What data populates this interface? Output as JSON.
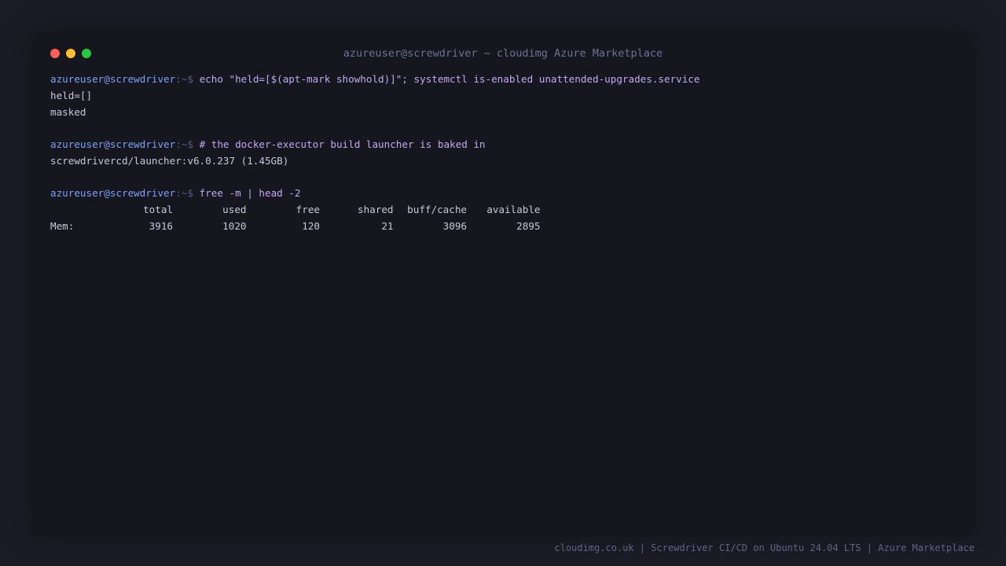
{
  "window": {
    "title": "azureuser@screwdriver ~ cloudimg Azure Marketplace",
    "controls": [
      {
        "name": "close",
        "color": "#ff5f57"
      },
      {
        "name": "minimize",
        "color": "#febc2e"
      },
      {
        "name": "maximize",
        "color": "#28c840"
      }
    ]
  },
  "terminal": {
    "prompt_user": "azureuser@screwdriver",
    "prompt_path": ":~$",
    "commands": [
      {
        "command": "echo \"held=[$(apt-mark showhold)]\"; systemctl is-enabled unattended-upgrades.service",
        "output": [
          "held=[]",
          "masked"
        ]
      },
      {
        "command": "# the docker-executor build launcher is baked in",
        "output": [
          "screwdrivercd/launcher:v6.0.237 (1.45GB)"
        ]
      },
      {
        "command": "free -m | head -2",
        "table": {
          "headers": [
            "",
            "total",
            "used",
            "free",
            "shared",
            "buff/cache",
            "available"
          ],
          "rows": [
            [
              "Mem:",
              "3916",
              "1020",
              "120",
              "21",
              "3096",
              "2895"
            ]
          ]
        }
      }
    ]
  },
  "footer": {
    "text": "cloudimg.co.uk | Screwdriver CI/CD on Ubuntu 24.04 LTS | Azure Marketplace"
  },
  "colors": {
    "background": "#1b1c26",
    "window": "#16161f",
    "prompt_user": "#7aa2f7",
    "prompt_path": "#565f89",
    "command": "#c4a7f5",
    "output": "#c3c8db"
  }
}
